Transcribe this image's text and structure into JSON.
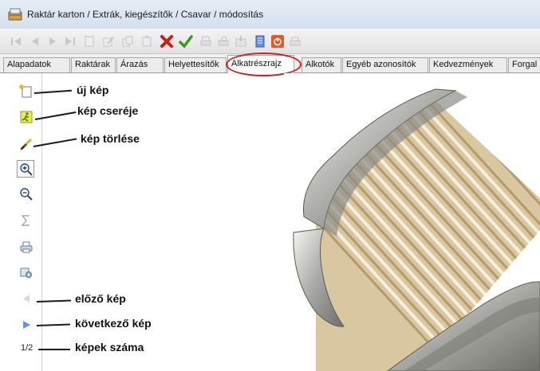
{
  "window": {
    "title": "Raktár karton / Extrák, kiegészítők / Csavar / módosítás"
  },
  "toolbar": {
    "buttons": [
      {
        "icon": "first-record-icon",
        "enabled": false
      },
      {
        "icon": "previous-record-icon",
        "enabled": false
      },
      {
        "icon": "next-record-icon",
        "enabled": false
      },
      {
        "icon": "last-record-icon",
        "enabled": false
      },
      {
        "icon": "new-record-icon",
        "enabled": false
      },
      {
        "icon": "edit-record-icon",
        "enabled": false
      },
      {
        "icon": "copy-record-icon",
        "enabled": false
      },
      {
        "icon": "paste-record-icon",
        "enabled": false
      },
      {
        "icon": "cancel-icon",
        "enabled": true,
        "color": "#d11a1a"
      },
      {
        "icon": "ok-check-icon",
        "enabled": true,
        "color": "#2e9e1f"
      },
      {
        "icon": "print-icon",
        "enabled": false
      },
      {
        "icon": "print-preview-icon",
        "enabled": false
      },
      {
        "icon": "export-icon",
        "enabled": false
      },
      {
        "icon": "notes-icon",
        "enabled": true
      },
      {
        "icon": "power-icon",
        "enabled": true,
        "color": "#e8562a"
      },
      {
        "icon": "print-small-icon",
        "enabled": false
      }
    ]
  },
  "tabs": [
    {
      "label": "Alapadatok",
      "active": false
    },
    {
      "label": "Raktárak",
      "active": false
    },
    {
      "label": "Árazás",
      "active": false
    },
    {
      "label": "Helyettesítők",
      "active": false
    },
    {
      "label": "Alkatrészrajz",
      "active": true
    },
    {
      "label": "Alkotók",
      "active": false
    },
    {
      "label": "Egyéb azonosítók",
      "active": false
    },
    {
      "label": "Kedvezmények",
      "active": false
    },
    {
      "label": "Forgal",
      "active": false
    }
  ],
  "highlight_color": "#d81e1e",
  "side_toolbar": {
    "buttons": [
      {
        "icon": "new-image-icon",
        "enabled": true
      },
      {
        "icon": "replace-image-icon",
        "enabled": true
      },
      {
        "icon": "delete-image-icon",
        "enabled": true
      },
      {
        "icon": "zoom-in-icon",
        "enabled": true
      },
      {
        "icon": "zoom-out-icon",
        "enabled": true
      },
      {
        "icon": "sum-icon",
        "enabled": false
      },
      {
        "icon": "print-icon",
        "enabled": true
      },
      {
        "icon": "settings-icon",
        "enabled": true
      },
      {
        "icon": "previous-image-icon",
        "enabled": false
      },
      {
        "icon": "next-image-icon",
        "enabled": true
      }
    ],
    "page_count": "1/2"
  },
  "annotations": {
    "new_image": "új kép",
    "replace_image": "kép cseréje",
    "delete_image": "kép törlése",
    "previous_image": "előző kép",
    "next_image": "következő kép",
    "image_count": "képek száma"
  }
}
